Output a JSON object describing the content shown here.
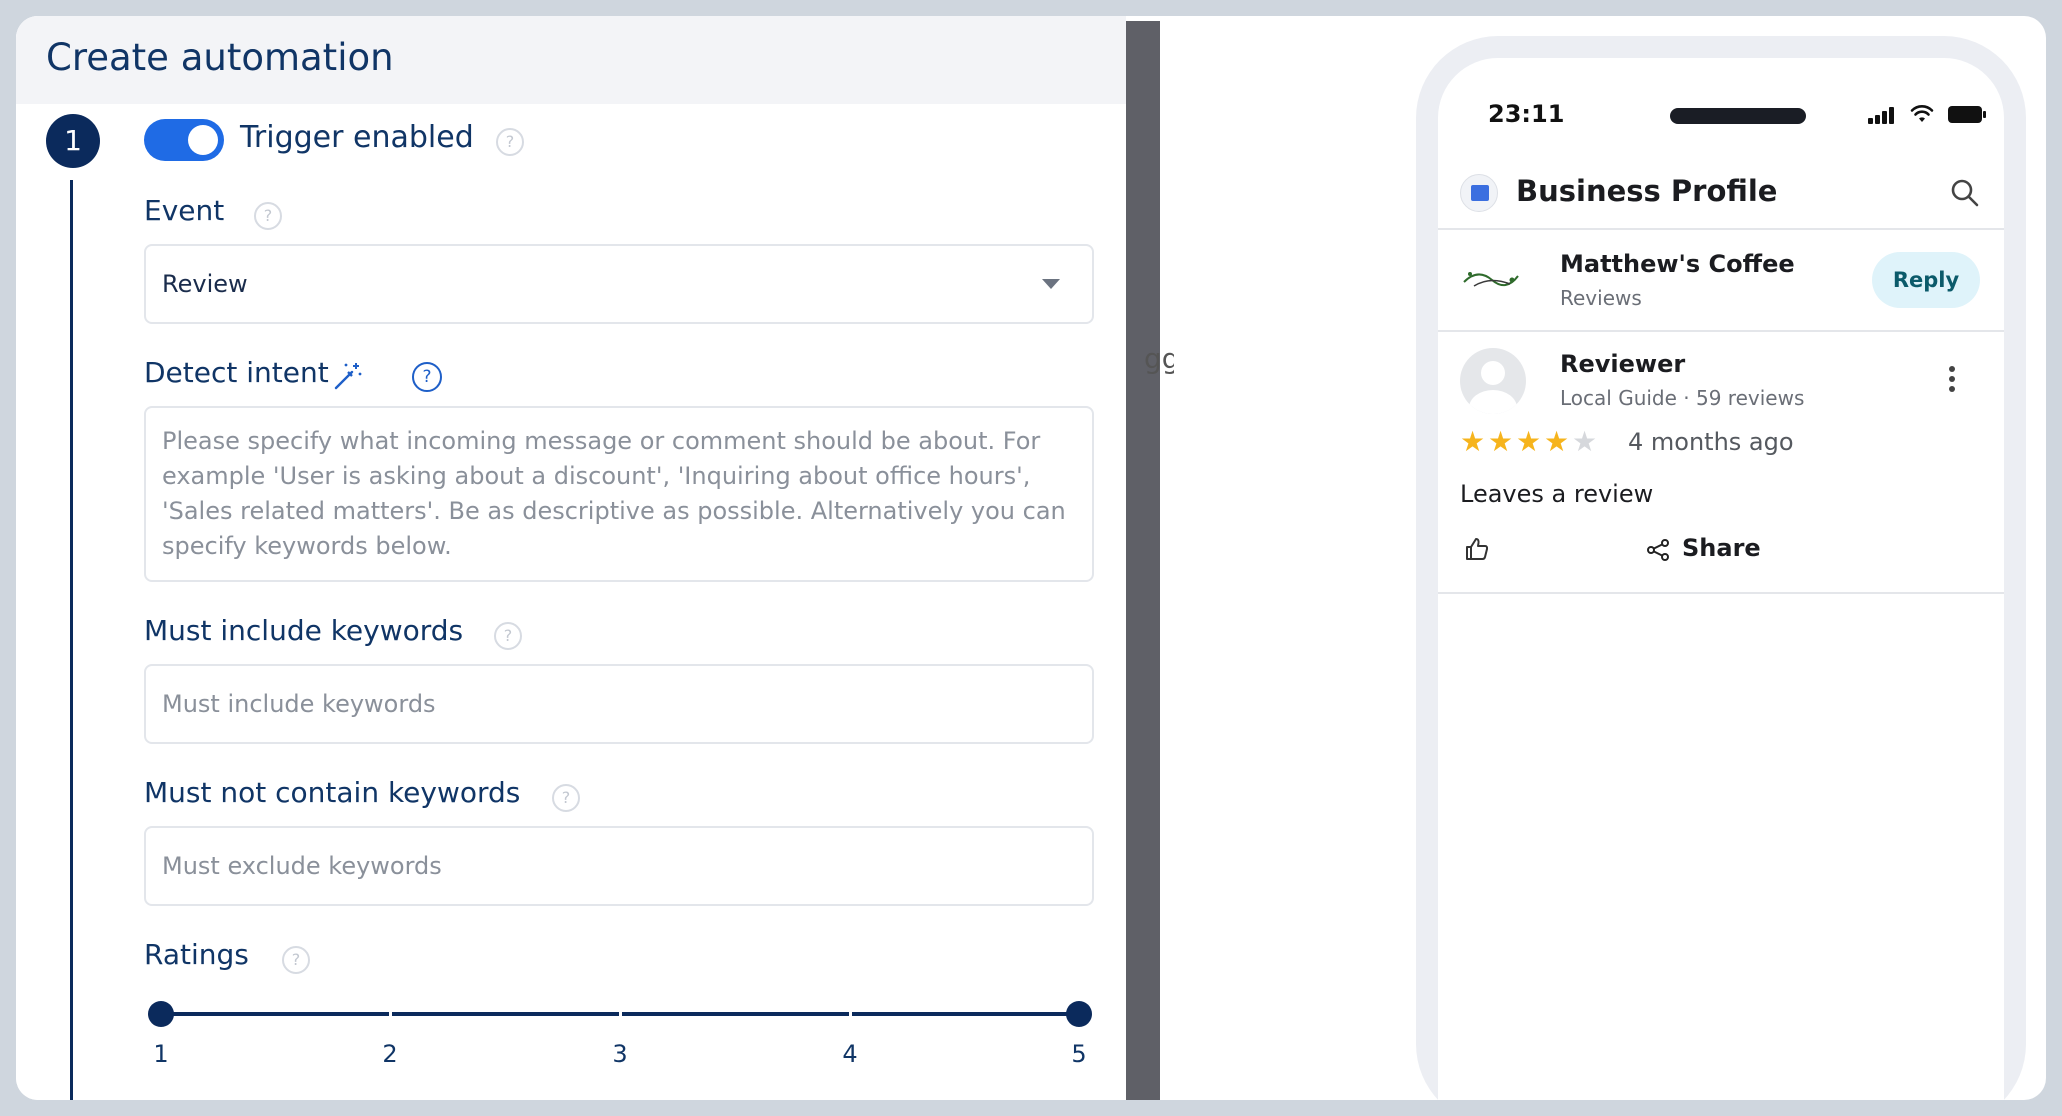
{
  "header": {
    "title": "Create automation"
  },
  "step": {
    "number": "1"
  },
  "trigger": {
    "label": "Trigger enabled",
    "enabled": true
  },
  "event": {
    "label": "Event",
    "value": "Review"
  },
  "intent": {
    "label": "Detect intent",
    "placeholder": "Please specify what incoming message or comment should be about. For example 'User is asking about a discount', 'Inquiring about office hours', 'Sales related matters'. Be as descriptive as possible. Alternatively you can specify keywords below."
  },
  "include": {
    "label": "Must include keywords",
    "placeholder": "Must include keywords"
  },
  "exclude": {
    "label": "Must not contain keywords",
    "placeholder": "Must exclude keywords"
  },
  "ratings": {
    "label": "Ratings",
    "ticks": [
      "1",
      "2",
      "3",
      "4",
      "5"
    ],
    "min": 1,
    "max": 5
  },
  "help_glyph": "?",
  "divider_ghost_text": "ggi",
  "phone": {
    "status_time": "23:11",
    "app_title": "Business Profile",
    "business": {
      "name": "Matthew's Coffee",
      "sub": "Reviews",
      "reply_label": "Reply"
    },
    "review": {
      "reviewer": "Reviewer",
      "meta": "Local Guide · 59 reviews",
      "stars": 4,
      "time": "4 months ago",
      "text": "Leaves a review",
      "share_label": "Share"
    }
  },
  "colors": {
    "accent": "#1f6be5",
    "navy": "#0b2a5c",
    "star_filled": "#f6b41d",
    "star_empty": "#d6d8dc"
  }
}
